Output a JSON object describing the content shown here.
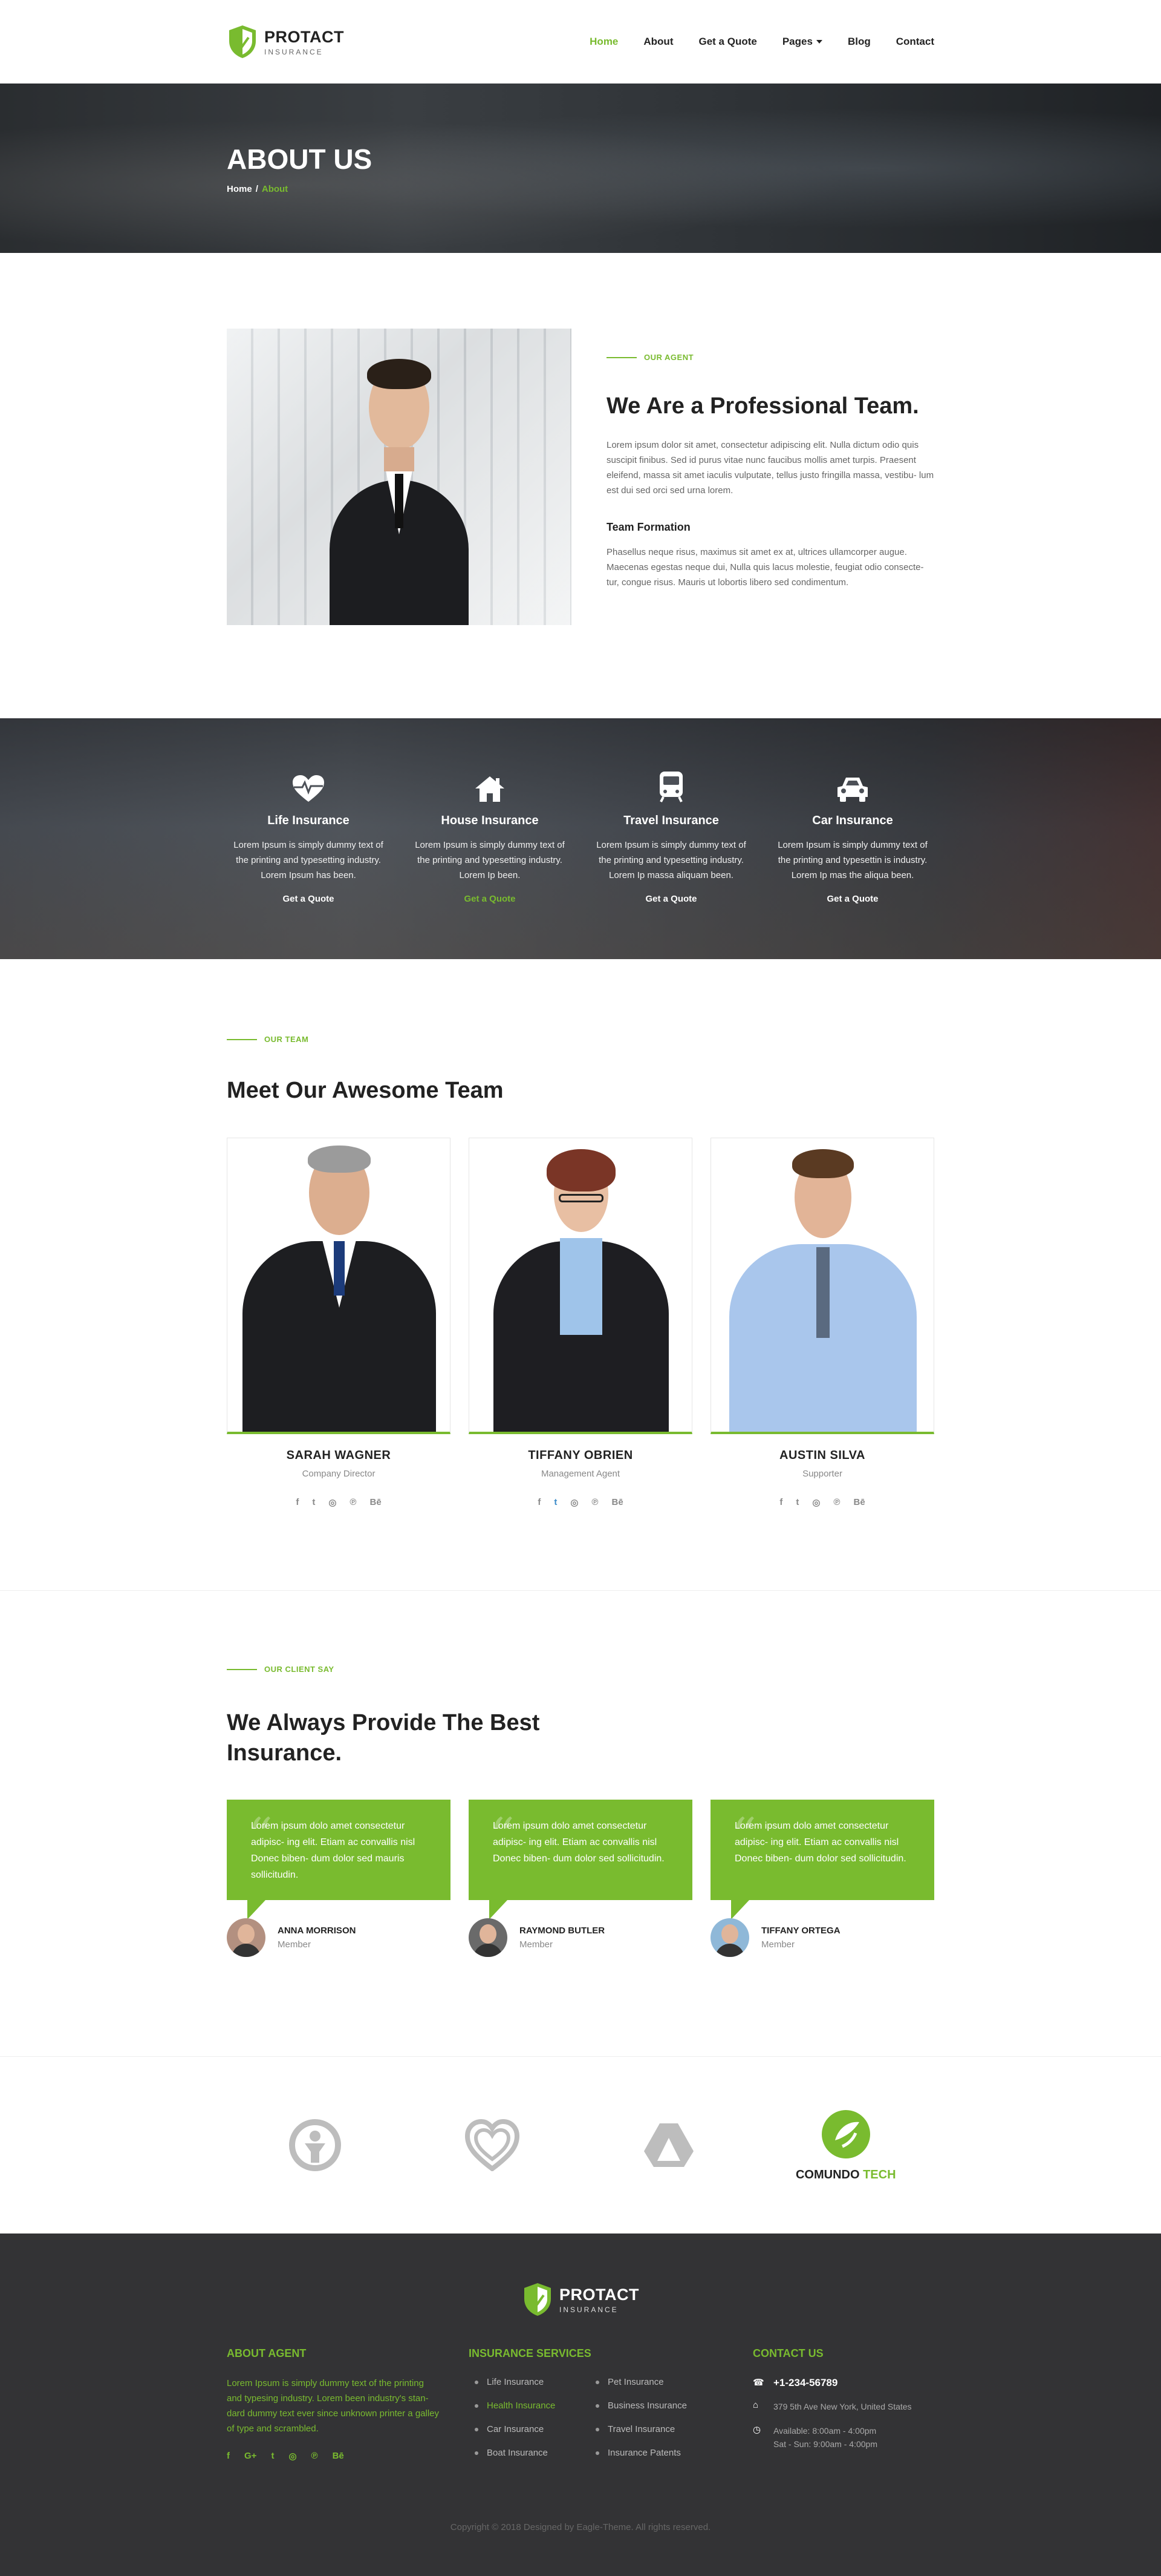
{
  "brand": {
    "name": "PROTACT",
    "sub": "INSURANCE",
    "accent": "#79bb2f"
  },
  "nav": {
    "items": [
      {
        "label": "Home",
        "active": true
      },
      {
        "label": "About"
      },
      {
        "label": "Get a Quote"
      },
      {
        "label": "Pages"
      },
      {
        "label": "Blog"
      },
      {
        "label": "Contact"
      }
    ]
  },
  "hero": {
    "title": "ABOUT US",
    "crumb_home": "Home",
    "crumb_sep": "/",
    "crumb_current": "About"
  },
  "about": {
    "tag": "OUR AGENT",
    "heading": "We Are a Professional Team.",
    "para1": "Lorem ipsum dolor sit amet, consectetur adipiscing elit. Nulla dictum odio quis suscipit finibus. Sed id purus vitae nunc faucibus mollis amet turpis. Praesent eleifend, massa sit amet iaculis vulputate, tellus justo fringilla massa, vestibu- lum est dui sed orci sed urna lorem.",
    "subheading": "Team Formation",
    "para2": "Phasellus neque risus, maximus sit amet ex at, ultrices ullamcorper augue. Maecenas egestas neque dui, Nulla quis lacus molestie, feugiat odio consecte- tur, congue risus. Mauris ut lobortis libero sed condimentum."
  },
  "services": [
    {
      "icon": "heartbeat-icon",
      "title": "Life Insurance",
      "text": "Lorem Ipsum is simply dummy text of the printing and typesetting industry. Lorem Ipsum has been.",
      "link": "Get a Quote"
    },
    {
      "icon": "house-icon",
      "title": "House Insurance",
      "text": "Lorem Ipsum is simply dummy text of the printing and typesetting industry. Lorem Ip been.",
      "link": "Get a Quote",
      "highlight": true
    },
    {
      "icon": "train-icon",
      "title": "Travel Insurance",
      "text": "Lorem Ipsum is simply dummy text of the printing and typesetting industry. Lorem Ip massa aliquam been.",
      "link": "Get a Quote"
    },
    {
      "icon": "car-icon",
      "title": "Car Insurance",
      "text": "Lorem Ipsum is simply dummy text of the printing and typesettin is industry. Lorem Ip mas the aliqua been.",
      "link": "Get a Quote"
    }
  ],
  "team": {
    "tag": "OUR TEAM",
    "heading": "Meet Our Awesome Team",
    "members": [
      {
        "name": "SARAH WAGNER",
        "role": "Company Director"
      },
      {
        "name": "TIFFANY OBRIEN",
        "role": "Management Agent"
      },
      {
        "name": "AUSTIN SILVA",
        "role": "Supporter"
      }
    ],
    "social": [
      "f",
      "t",
      "◎",
      "℗",
      "Bē"
    ]
  },
  "testimonials": {
    "tag": "OUR CLIENT SAY",
    "heading": "We Always Provide The Best Insurance.",
    "items": [
      {
        "text": "Lorem ipsum dolo amet consectetur adipisc- ing elit. Etiam ac convallis nisl Donec biben- dum dolor sed mauris sollicitudin.",
        "name": "ANNA MORRISON",
        "role": "Member"
      },
      {
        "text": "Lorem ipsum dolo amet consectetur adipisc- ing elit. Etiam ac convallis nisl Donec biben- dum dolor sed sollicitudin.",
        "name": "RAYMOND BUTLER",
        "role": "Member"
      },
      {
        "text": "Lorem ipsum dolo amet consectetur adipisc- ing elit. Etiam ac convallis nisl Donec biben- dum dolor sed sollicitudin.",
        "name": "TIFFANY ORTEGA",
        "role": "Member"
      }
    ]
  },
  "partners": {
    "last_name_a": "COMUNDO",
    "last_name_b": "TECH"
  },
  "footer": {
    "about_title": "ABOUT AGENT",
    "about_text": "Lorem Ipsum is simply dummy text of the printing and typesing industry. Lorem been industry's stan- dard dummy text ever since unknown printer a galley of type and scrambled.",
    "social": [
      "f",
      "G+",
      "t",
      "◎",
      "℗",
      "Bē"
    ],
    "ins_title": "INSURANCE SERVICES",
    "ins_items": [
      "Life Insurance",
      "Pet Insurance",
      "Health Insurance",
      "Business Insurance",
      "Car Insurance",
      "Travel Insurance",
      "Boat Insurance",
      "Insurance Patents"
    ],
    "contact_title": "CONTACT US",
    "phone": "+1-234-56789",
    "address": "379 5th Ave New York, United States",
    "hours1": "Available: 8:00am - 4:00pm",
    "hours2": "Sat - Sun: 9:00am - 4:00pm",
    "copyright": "Copyright © 2018 Designed by Eagle-Theme. All rights reserved."
  }
}
